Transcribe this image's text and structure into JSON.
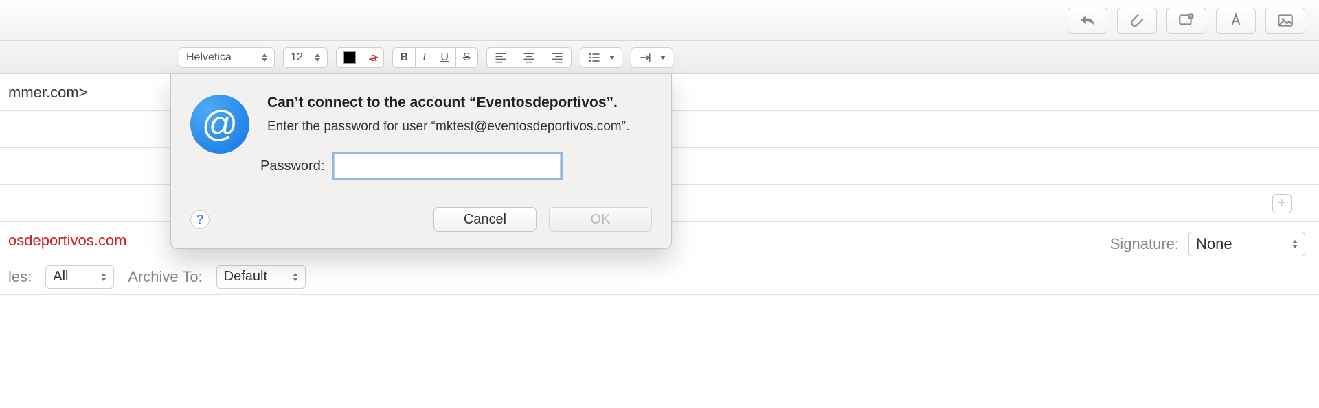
{
  "format": {
    "font_name": "Helvetica",
    "font_size": "12"
  },
  "compose": {
    "to_fragment": "mmer.com>",
    "from_fragment": "osdeportivos.com"
  },
  "signature": {
    "label": "Signature:",
    "value": "None"
  },
  "rules": {
    "label": "les:",
    "value": "All"
  },
  "archive": {
    "label": "Archive To:",
    "value": "Default"
  },
  "dialog": {
    "title": "Can’t connect to the account “Eventosdeportivos”.",
    "subtitle": "Enter the password for user “mktest@eventosdeportivos.com”.",
    "password_label": "Password:",
    "cancel": "Cancel",
    "ok": "OK"
  }
}
